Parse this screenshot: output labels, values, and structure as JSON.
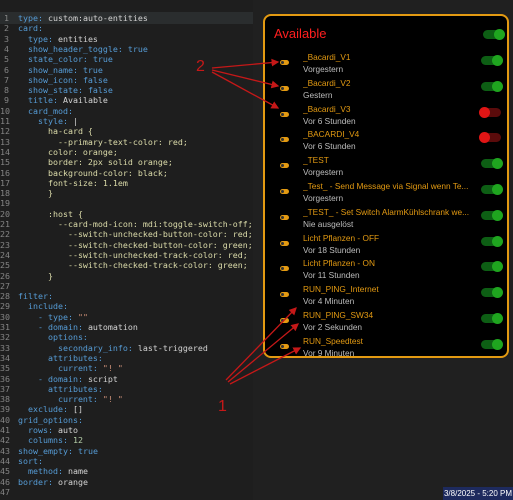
{
  "editor": {
    "lines": [
      {
        "n": "1",
        "t": [
          {
            "c": "k",
            "v": "type: "
          },
          {
            "c": "v",
            "v": "custom:auto-entities"
          }
        ]
      },
      {
        "n": "2",
        "t": [
          {
            "c": "k",
            "v": "card:"
          }
        ]
      },
      {
        "n": "3",
        "t": [
          {
            "c": "k",
            "v": "  type: "
          },
          {
            "c": "v",
            "v": "entities"
          }
        ]
      },
      {
        "n": "4",
        "t": [
          {
            "c": "k",
            "v": "  show_header_toggle: "
          },
          {
            "c": "b",
            "v": "true"
          }
        ]
      },
      {
        "n": "5",
        "t": [
          {
            "c": "k",
            "v": "  state_color: "
          },
          {
            "c": "b",
            "v": "true"
          }
        ]
      },
      {
        "n": "6",
        "t": [
          {
            "c": "k",
            "v": "  show_name: "
          },
          {
            "c": "b",
            "v": "true"
          }
        ]
      },
      {
        "n": "7",
        "t": [
          {
            "c": "k",
            "v": "  show_icon: "
          },
          {
            "c": "b",
            "v": "false"
          }
        ]
      },
      {
        "n": "8",
        "t": [
          {
            "c": "k",
            "v": "  show_state: "
          },
          {
            "c": "b",
            "v": "false"
          }
        ]
      },
      {
        "n": "9",
        "t": [
          {
            "c": "k",
            "v": "  title: "
          },
          {
            "c": "v",
            "v": "Available"
          }
        ]
      },
      {
        "n": "10",
        "t": [
          {
            "c": "k",
            "v": "  card_mod:"
          }
        ]
      },
      {
        "n": "11",
        "t": [
          {
            "c": "k",
            "v": "    style: "
          },
          {
            "c": "v",
            "v": "|"
          }
        ]
      },
      {
        "n": "12",
        "t": [
          {
            "c": "p",
            "v": "      ha-card {"
          }
        ]
      },
      {
        "n": "13",
        "t": [
          {
            "c": "p",
            "v": "        --primary-text-color: red;"
          }
        ]
      },
      {
        "n": "14",
        "t": [
          {
            "c": "p",
            "v": "      color: orange;"
          }
        ]
      },
      {
        "n": "15",
        "t": [
          {
            "c": "p",
            "v": "      border: 2px solid orange;"
          }
        ]
      },
      {
        "n": "16",
        "t": [
          {
            "c": "p",
            "v": "      background-color: black;"
          }
        ]
      },
      {
        "n": "17",
        "t": [
          {
            "c": "p",
            "v": "      font-size: 1.1em"
          }
        ]
      },
      {
        "n": "18",
        "t": [
          {
            "c": "p",
            "v": "      }"
          }
        ]
      },
      {
        "n": "19",
        "t": []
      },
      {
        "n": "20",
        "t": [
          {
            "c": "p",
            "v": "      :host {"
          }
        ]
      },
      {
        "n": "21",
        "t": [
          {
            "c": "p",
            "v": "        --card-mod-icon: mdi:toggle-switch-off;"
          }
        ]
      },
      {
        "n": "22",
        "t": [
          {
            "c": "p",
            "v": "          --switch-unchecked-button-color: red;"
          }
        ]
      },
      {
        "n": "23",
        "t": [
          {
            "c": "p",
            "v": "          --switch-checked-button-color: green;"
          }
        ]
      },
      {
        "n": "24",
        "t": [
          {
            "c": "p",
            "v": "          --switch-unchecked-track-color: red;"
          }
        ]
      },
      {
        "n": "25",
        "t": [
          {
            "c": "p",
            "v": "          --switch-checked-track-color: green;"
          }
        ]
      },
      {
        "n": "26",
        "t": [
          {
            "c": "p",
            "v": "      }"
          }
        ]
      },
      {
        "n": "27",
        "t": []
      },
      {
        "n": "28",
        "t": [
          {
            "c": "k",
            "v": "filter:"
          }
        ]
      },
      {
        "n": "29",
        "t": [
          {
            "c": "k",
            "v": "  include:"
          }
        ]
      },
      {
        "n": "30",
        "t": [
          {
            "c": "k",
            "v": "    - type: "
          },
          {
            "c": "s",
            "v": "\"\""
          }
        ]
      },
      {
        "n": "31",
        "t": [
          {
            "c": "k",
            "v": "    - domain: "
          },
          {
            "c": "v",
            "v": "automation"
          }
        ]
      },
      {
        "n": "32",
        "t": [
          {
            "c": "k",
            "v": "      options:"
          }
        ]
      },
      {
        "n": "33",
        "t": [
          {
            "c": "k",
            "v": "        secondary_info: "
          },
          {
            "c": "v",
            "v": "last-triggered"
          }
        ]
      },
      {
        "n": "34",
        "t": [
          {
            "c": "k",
            "v": "      attributes:"
          }
        ]
      },
      {
        "n": "35",
        "t": [
          {
            "c": "k",
            "v": "        current: "
          },
          {
            "c": "s",
            "v": "\"! \""
          }
        ]
      },
      {
        "n": "36",
        "t": [
          {
            "c": "k",
            "v": "    - domain: "
          },
          {
            "c": "v",
            "v": "script"
          }
        ]
      },
      {
        "n": "37",
        "t": [
          {
            "c": "k",
            "v": "      attributes:"
          }
        ]
      },
      {
        "n": "38",
        "t": [
          {
            "c": "k",
            "v": "        current: "
          },
          {
            "c": "s",
            "v": "\"! \""
          }
        ]
      },
      {
        "n": "39",
        "t": [
          {
            "c": "k",
            "v": "  exclude: "
          },
          {
            "c": "v",
            "v": "[]"
          }
        ]
      },
      {
        "n": "40",
        "t": [
          {
            "c": "k",
            "v": "grid_options:"
          }
        ]
      },
      {
        "n": "41",
        "t": [
          {
            "c": "k",
            "v": "  rows: "
          },
          {
            "c": "v",
            "v": "auto"
          }
        ]
      },
      {
        "n": "42",
        "t": [
          {
            "c": "k",
            "v": "  columns: "
          },
          {
            "c": "c",
            "v": "12"
          }
        ]
      },
      {
        "n": "43",
        "t": [
          {
            "c": "k",
            "v": "show_empty: "
          },
          {
            "c": "b",
            "v": "true"
          }
        ]
      },
      {
        "n": "44",
        "t": [
          {
            "c": "k",
            "v": "sort:"
          }
        ]
      },
      {
        "n": "45",
        "t": [
          {
            "c": "k",
            "v": "  method: "
          },
          {
            "c": "v",
            "v": "name"
          }
        ]
      },
      {
        "n": "46",
        "t": [
          {
            "c": "k",
            "v": "border: "
          },
          {
            "c": "v",
            "v": "orange"
          }
        ]
      },
      {
        "n": "47",
        "t": []
      }
    ]
  },
  "card": {
    "title": "Available",
    "header_toggle_state": "on",
    "rows": [
      {
        "name": "_Bacardi_V1",
        "sub": "Vorgestern",
        "state": "on"
      },
      {
        "name": "_Bacardi_V2",
        "sub": "Gestern",
        "state": "on"
      },
      {
        "name": "_Bacardi_V3",
        "sub": "Vor 6 Stunden",
        "state": "off"
      },
      {
        "name": "_BACARDI_V4",
        "sub": "Vor 6 Stunden",
        "state": "off"
      },
      {
        "name": "_TEST",
        "sub": "Vorgestern",
        "state": "on"
      },
      {
        "name": "_Test_ - Send Message via Signal wenn Te...",
        "sub": "Vorgestern",
        "state": "on"
      },
      {
        "name": "_TEST_ - Set Switch AlarmKühlschrank we...",
        "sub": "Nie ausgelöst",
        "state": "on"
      },
      {
        "name": "Licht Pflanzen - OFF",
        "sub": "Vor 18 Stunden",
        "state": "on"
      },
      {
        "name": "Licht Pflanzen - ON",
        "sub": "Vor 11 Stunden",
        "state": "on"
      },
      {
        "name": "RUN_PING_Internet",
        "sub": "Vor 4 Minuten",
        "state": "on"
      },
      {
        "name": "RUN_PING_SW34",
        "sub": "Vor 2 Sekunden",
        "state": "on"
      },
      {
        "name": "RUN_Speedtest",
        "sub": "Vor 9 Minuten",
        "state": "on"
      }
    ]
  },
  "annotations": {
    "label_1": "1",
    "label_2": "2"
  },
  "taskbar": {
    "datetime": "3/8/2025 - 5:20 PM"
  },
  "colors": {
    "accent": "#e39a12",
    "title": "#ff1f1f",
    "toggle_on": "#1fa51f",
    "toggle_off": "#e01515",
    "annotation": "#c51818"
  }
}
